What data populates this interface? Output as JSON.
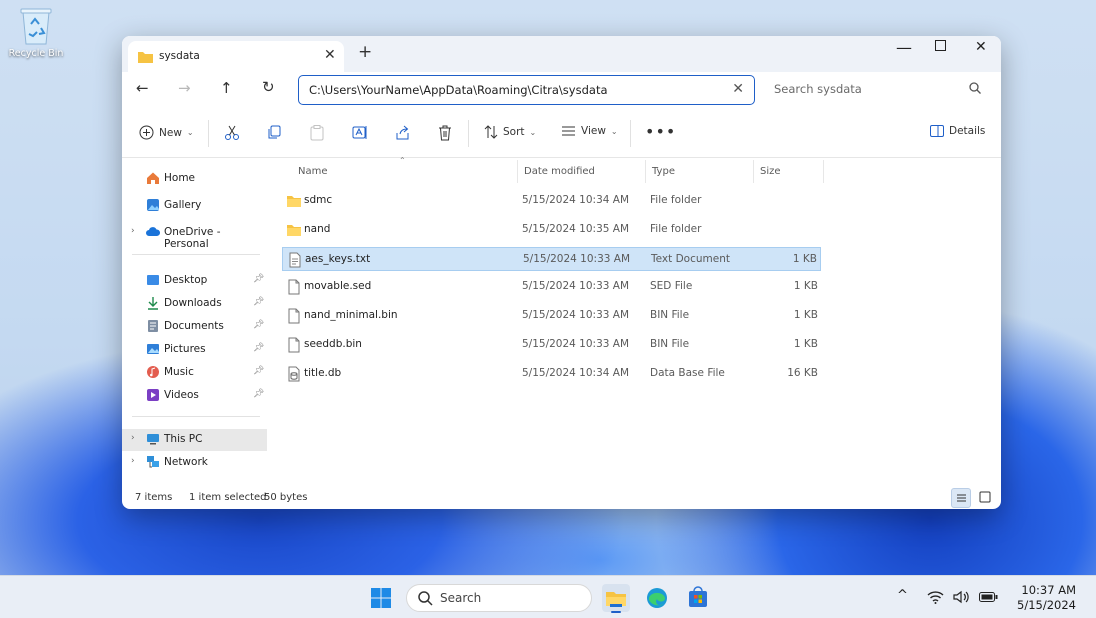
{
  "desktop": {
    "recycle_bin": "Recycle Bin"
  },
  "window": {
    "tab_title": "sysdata",
    "address": "C:\\Users\\YourName\\AppData\\Roaming\\Citra\\sysdata",
    "search_placeholder": "Search sysdata"
  },
  "toolbar": {
    "new": "New",
    "sort": "Sort",
    "view": "View",
    "details": "Details"
  },
  "sidebar": {
    "home": "Home",
    "gallery": "Gallery",
    "onedrive": "OneDrive - Personal",
    "desktop": "Desktop",
    "downloads": "Downloads",
    "documents": "Documents",
    "pictures": "Pictures",
    "music": "Music",
    "videos": "Videos",
    "this_pc": "This PC",
    "network": "Network"
  },
  "columns": {
    "name": "Name",
    "date": "Date modified",
    "type": "Type",
    "size": "Size"
  },
  "files": [
    {
      "name": "sdmc",
      "date": "5/15/2024 10:34 AM",
      "type": "File folder",
      "size": "",
      "icon": "folder"
    },
    {
      "name": "nand",
      "date": "5/15/2024 10:35 AM",
      "type": "File folder",
      "size": "",
      "icon": "folder"
    },
    {
      "name": "aes_keys.txt",
      "date": "5/15/2024 10:33 AM",
      "type": "Text Document",
      "size": "1 KB",
      "icon": "text-file",
      "selected": true
    },
    {
      "name": "movable.sed",
      "date": "5/15/2024 10:33 AM",
      "type": "SED File",
      "size": "1 KB",
      "icon": "file"
    },
    {
      "name": "nand_minimal.bin",
      "date": "5/15/2024 10:33 AM",
      "type": "BIN File",
      "size": "1 KB",
      "icon": "file"
    },
    {
      "name": "seeddb.bin",
      "date": "5/15/2024 10:33 AM",
      "type": "BIN File",
      "size": "1 KB",
      "icon": "file"
    },
    {
      "name": "title.db",
      "date": "5/15/2024 10:34 AM",
      "type": "Data Base File",
      "size": "16 KB",
      "icon": "db-file"
    }
  ],
  "status": {
    "items": "7 items",
    "selected": "1 item selected",
    "size": "50 bytes"
  },
  "taskbar": {
    "search": "Search",
    "time": "10:37 AM",
    "date": "5/15/2024"
  },
  "colors": {
    "accent": "#1f5fc8",
    "selection": "#cfe4f8",
    "folder": "#f6c343"
  }
}
